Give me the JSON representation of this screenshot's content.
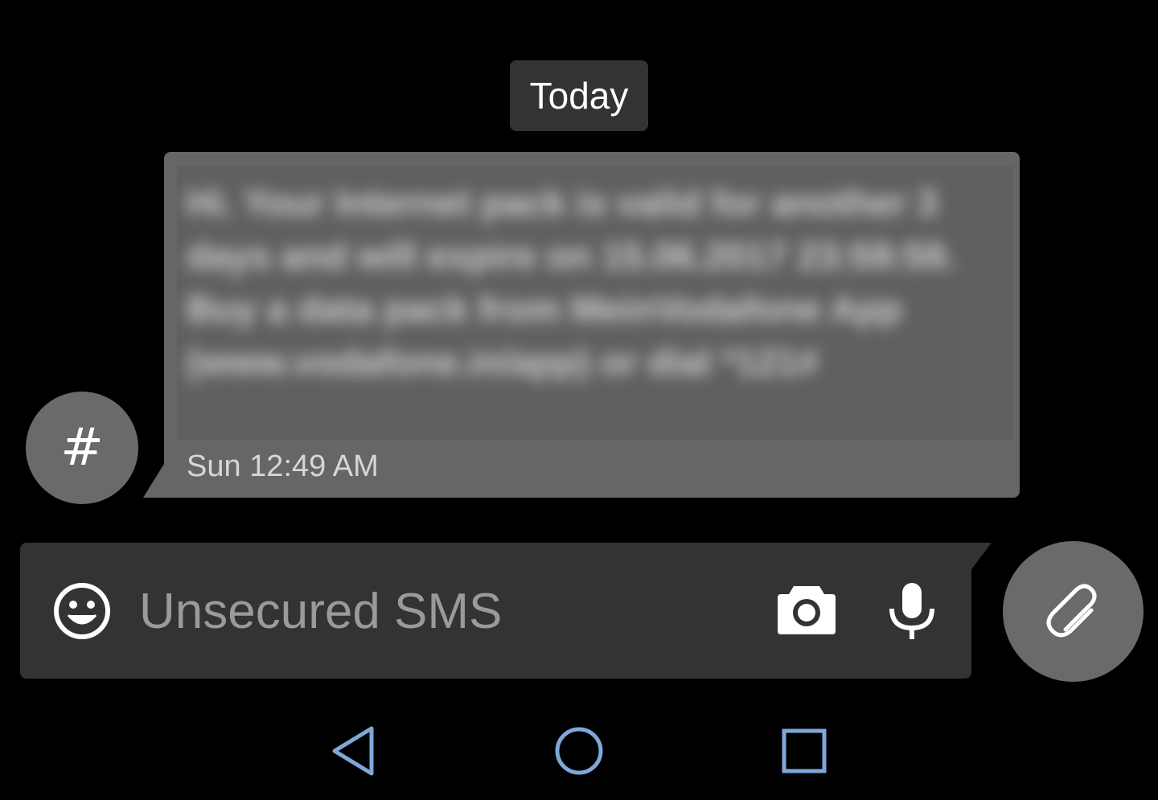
{
  "date_divider": {
    "label": "Today"
  },
  "message": {
    "sender_avatar_glyph": "#",
    "body": "Hi. Your Internet pack is valid for another 3 days and will expire on 15.06.2017 23:59:59. Buy a data pack from MeinVodafone App (www.vodafone.in/app) or dial *121#",
    "timestamp": "Sun 12:49 AM",
    "body_blurred": true
  },
  "compose": {
    "placeholder": "Unsecured SMS",
    "value": "",
    "icons": [
      "emoji-icon",
      "camera-icon",
      "microphone-icon"
    ]
  },
  "fab": {
    "icon": "paperclip-icon"
  },
  "navigation_bar": {
    "buttons": [
      "back-icon",
      "home-icon",
      "recents-icon"
    ],
    "color": "#7fa8d8"
  },
  "colors": {
    "background": "#000000",
    "bubble": "#666666",
    "compose_bar": "#333333",
    "fab": "#6a6a6a"
  }
}
